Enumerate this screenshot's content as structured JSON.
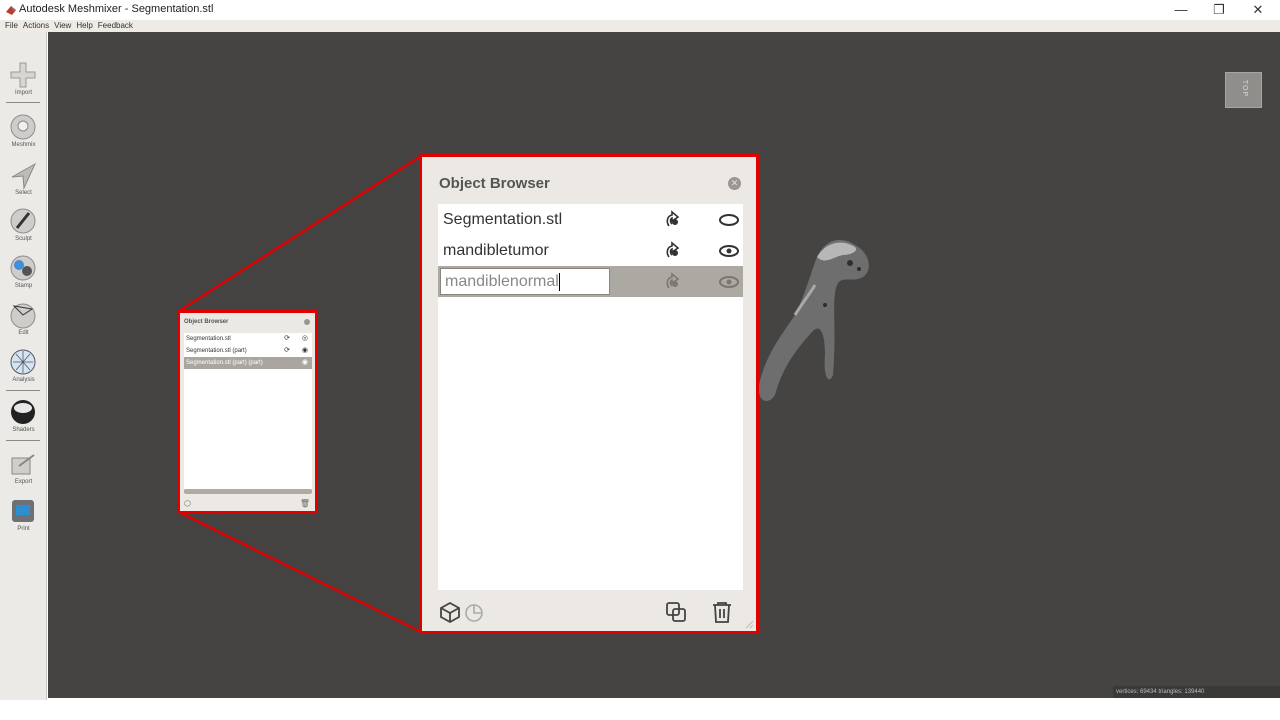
{
  "window": {
    "title": "Autodesk Meshmixer - Segmentation.stl",
    "minimize": "—",
    "restore": "❐",
    "close": "✕"
  },
  "menu": [
    "File",
    "Actions",
    "View",
    "Help",
    "Feedback"
  ],
  "toolbar": [
    {
      "label": "Import",
      "icon": "import-plus-icon"
    },
    {
      "label": "Meshmix",
      "icon": "meshmix-icon"
    },
    {
      "label": "Select",
      "icon": "select-arrow-icon"
    },
    {
      "label": "Sculpt",
      "icon": "sculpt-brush-icon"
    },
    {
      "label": "Stamp",
      "icon": "stamp-icon"
    },
    {
      "label": "Edit",
      "icon": "edit-icon"
    },
    {
      "label": "Analysis",
      "icon": "analysis-icon"
    },
    {
      "label": "Shaders",
      "icon": "shaders-icon"
    },
    {
      "label": "Export",
      "icon": "export-icon"
    },
    {
      "label": "Print",
      "icon": "print-icon"
    }
  ],
  "view_cube": {
    "label": "TOP"
  },
  "status": {
    "text": "vertices: 69434 triangles: 139440"
  },
  "small_browser": {
    "title": "Object Browser",
    "items": [
      {
        "name": "Segmentation.stl",
        "selected": false
      },
      {
        "name": "Segmentation.stl (part)",
        "selected": false
      },
      {
        "name": "Segmentation.stl (part) (part)",
        "selected": true
      }
    ]
  },
  "object_browser": {
    "title": "Object Browser",
    "items": [
      {
        "name": "Segmentation.stl",
        "visible": false,
        "selected": false
      },
      {
        "name": "mandibletumor",
        "visible": true,
        "selected": false
      },
      {
        "name": "mandiblenormal",
        "visible": true,
        "selected": true,
        "editing": true
      }
    ]
  },
  "colors": {
    "highlight": "#e00000",
    "viewport": "#454442",
    "panel": "#ece8e4",
    "selected_row": "#aca8a2"
  }
}
